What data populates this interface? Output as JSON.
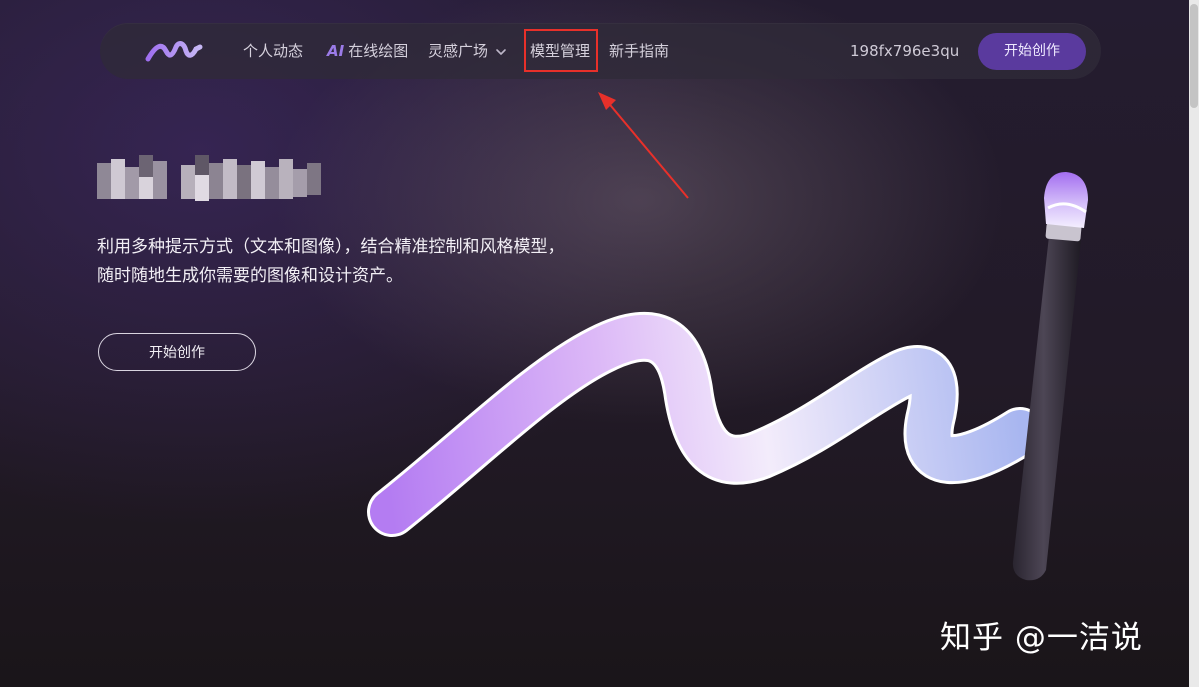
{
  "nav": {
    "logo_icon": "squiggle-logo-icon",
    "items": [
      {
        "label": "个人动态"
      },
      {
        "prefix": "AI",
        "label": "在线绘图"
      },
      {
        "label": "灵感广场",
        "icon": "chevron-down-icon"
      },
      {
        "label": "模型管理",
        "highlighted": true
      },
      {
        "label": "新手指南"
      }
    ],
    "user_id": "198fx796e3qu",
    "cta_label": "开始创作"
  },
  "hero": {
    "title_pixelated": true,
    "description": "利用多种提示方式（文本和图像），结合精准控制和风格模型，随时随地生成你需要的图像和设计资产。",
    "cta_label": "开始创作"
  },
  "watermark": "知乎 @一洁说",
  "colors": {
    "accent": "#5a3a9e",
    "highlight_box": "#e8302a",
    "annotation_arrow": "#e8302a",
    "brush_stroke_start": "#b47cf2",
    "brush_stroke_end": "#a8b6f0"
  }
}
